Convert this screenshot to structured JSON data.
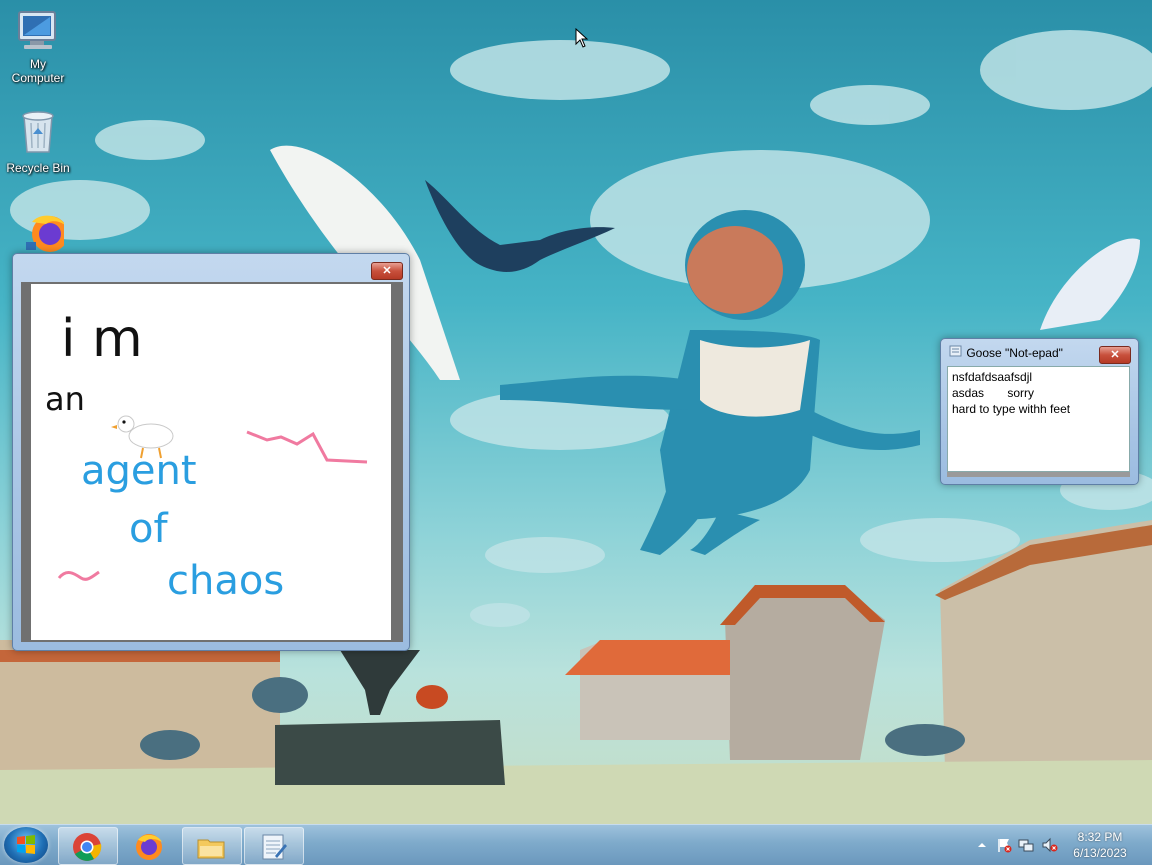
{
  "desktop": {
    "icons": [
      {
        "label_line1": "My",
        "label_line2": "Computer",
        "icon": "my-computer-icon"
      },
      {
        "label_line1": "Recycle Bin",
        "label_line2": "",
        "icon": "recycle-bin-icon"
      },
      {
        "label_line1": "",
        "label_line2": "",
        "icon": "firefox-icon"
      }
    ]
  },
  "paint_window": {
    "close_label": "✕",
    "drawing": {
      "line1": "i m",
      "line2": "an",
      "line3": "agent",
      "line4": "of",
      "line5": "chaos",
      "black_color": "#111111",
      "blue_color": "#2a9ee0",
      "pink_color": "#f07aa0"
    }
  },
  "notepad_window": {
    "title": "Goose \"Not-epad\"",
    "close_label": "✕",
    "lines": [
      "nsfdafdsaafsdjl",
      "asdas       sorry",
      "hard to type withh feet"
    ]
  },
  "taskbar": {
    "start_icon": "windows-logo-icon",
    "pinned": [
      "chrome-icon",
      "firefox-icon",
      "file-explorer-icon",
      "notepad-icon"
    ],
    "tray": [
      "show-hidden-icons-icon",
      "action-center-flag-icon",
      "network-icon",
      "volume-muted-icon"
    ],
    "time": "8:32 PM",
    "date": "6/13/2023"
  },
  "colors": {
    "taskbar": "#7eaacb",
    "window_frame": "#a9c5e5",
    "close_red": "#c8503c"
  }
}
